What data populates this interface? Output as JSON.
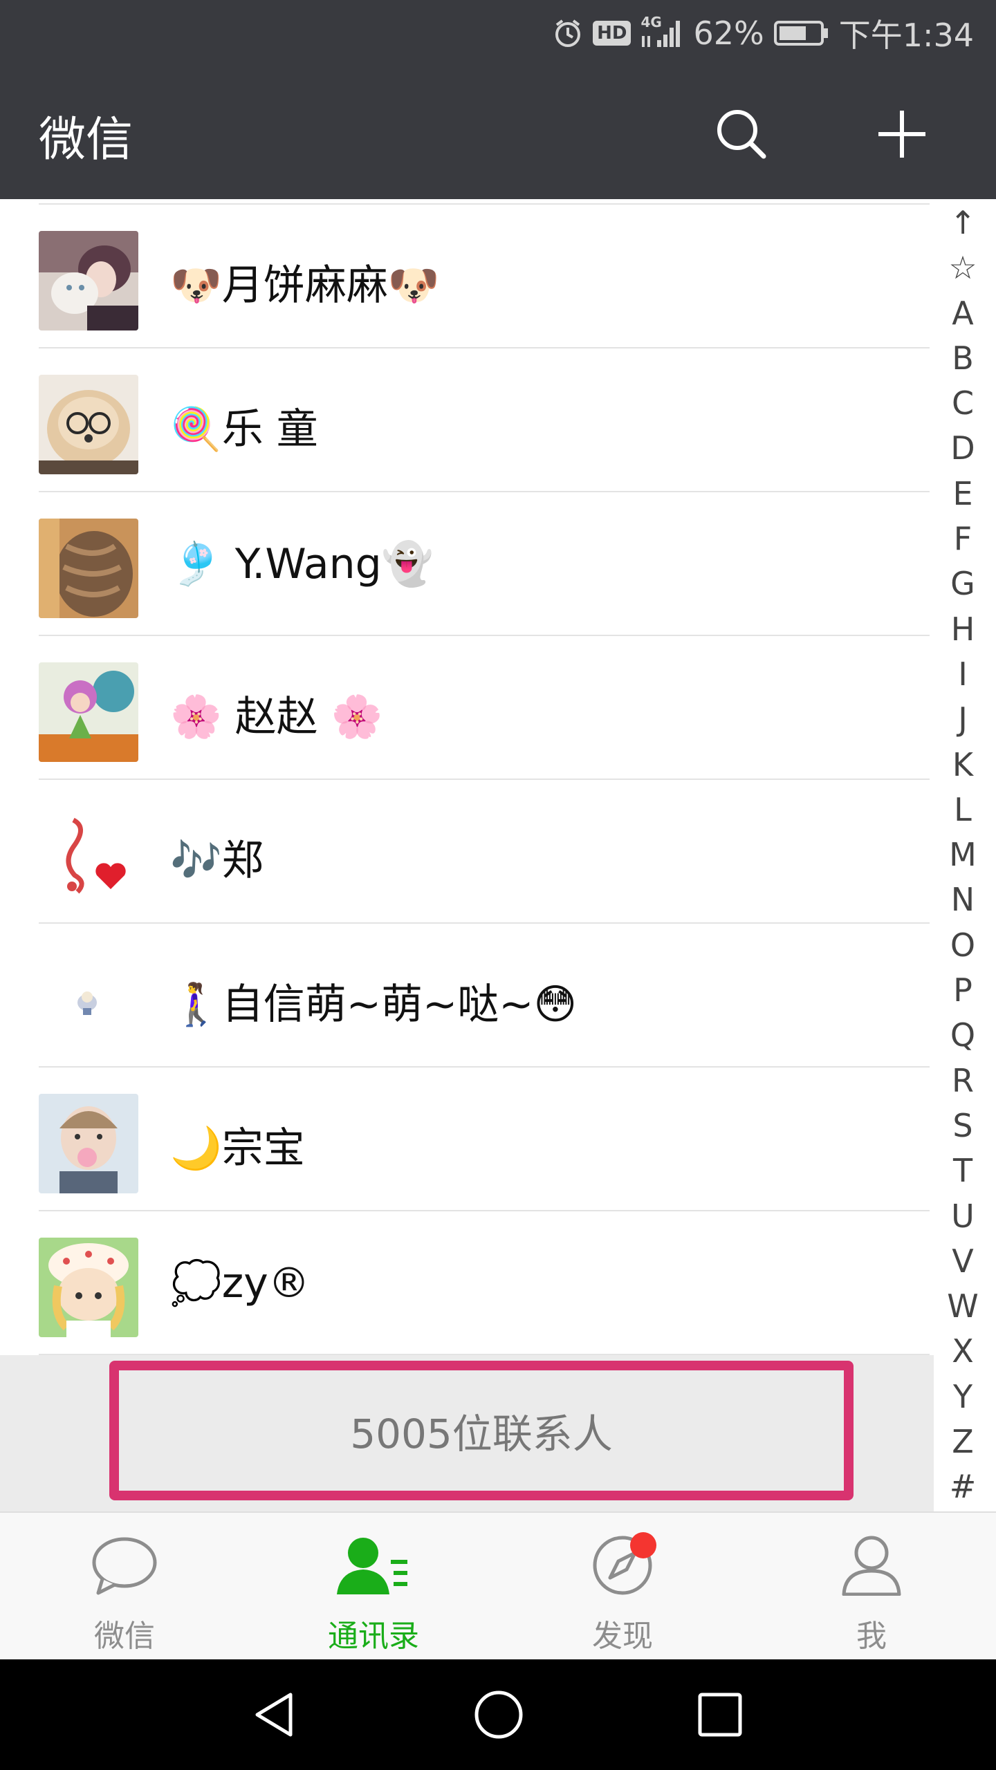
{
  "status_bar": {
    "battery_percent": "62%",
    "time": "下午1:34",
    "network": "4G",
    "hd_label": "HD"
  },
  "title_bar": {
    "title": "微信"
  },
  "contacts": [
    {
      "name": "🐶月饼麻麻🐶",
      "avatar": "photo-woman-with-cat"
    },
    {
      "name": "🍭乐 童",
      "avatar": "photo-dog-with-glasses"
    },
    {
      "name": "🎐 Y.Wang👻",
      "avatar": "photo-hair-braid"
    },
    {
      "name": "🌸 赵赵 🌸",
      "avatar": "drawing-girl-umbrella"
    },
    {
      "name": "🎶郑",
      "avatar": "music-note-heart"
    },
    {
      "name": "🚶‍♀️自信萌~萌~哒~😳",
      "avatar": "tiny-cartoon"
    },
    {
      "name": "🌙宗宝",
      "avatar": "photo-child-bubblegum"
    },
    {
      "name": "💭zy®",
      "avatar": "cartoon-girl-hat"
    }
  ],
  "index_letters": [
    "↑",
    "☆",
    "A",
    "B",
    "C",
    "D",
    "E",
    "F",
    "G",
    "H",
    "I",
    "J",
    "K",
    "L",
    "M",
    "N",
    "O",
    "P",
    "Q",
    "R",
    "S",
    "T",
    "U",
    "V",
    "W",
    "X",
    "Y",
    "Z",
    "#"
  ],
  "footer": {
    "count_text": "5005位联系人"
  },
  "tabs": [
    {
      "label": "微信",
      "icon": "chat-bubble-icon",
      "active": false
    },
    {
      "label": "通讯录",
      "icon": "contacts-icon",
      "active": true
    },
    {
      "label": "发现",
      "icon": "compass-icon",
      "active": false,
      "badge": true
    },
    {
      "label": "我",
      "icon": "person-icon",
      "active": false
    }
  ],
  "colors": {
    "header_bg": "#393a3f",
    "active_green": "#1aad19",
    "highlight_border": "#d8336f",
    "badge_red": "#f43530"
  }
}
